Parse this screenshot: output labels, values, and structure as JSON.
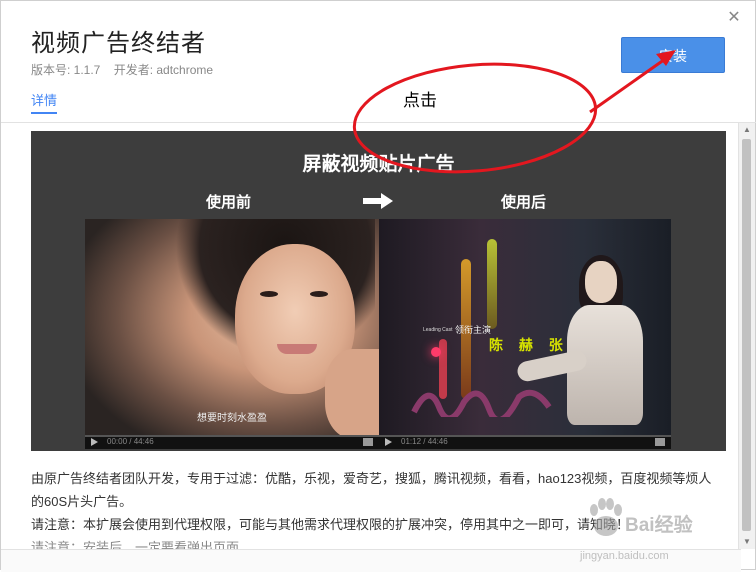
{
  "header": {
    "title": "视频广告终结者",
    "version_label": "版本号: 1.1.7",
    "developer_label": "开发者: adtchrome",
    "install_button": "安装",
    "tab_details": "详情",
    "close_glyph": "✕"
  },
  "banner": {
    "title": "屏蔽视频贴片广告",
    "before_label": "使用前",
    "after_label": "使用后",
    "before_subtitle": "想要时刻水盈盈",
    "after_credit_small": "Leading Cast",
    "after_credit_role": "领衔主演",
    "after_credit_names": "陈 赫 张 萌",
    "before_time": "00:00 / 44:46",
    "after_time": "01:12 / 44:46"
  },
  "annotation": {
    "label": "点击",
    "color": "#e3171f"
  },
  "description": {
    "line1": "由原广告终结者团队开发，专用于过滤：优酷，乐视，爱奇艺，搜狐，腾讯视频，看看，hao123视频，百度视频等烦人的60S片头广告。",
    "line2": "请注意：本扩展会使用到代理权限，可能与其他需求代理权限的扩展冲突，停用其中之一即可，请知晓！",
    "line3": "请注意：安装后，一定要看弹出页面"
  },
  "watermark": {
    "name": "Bai经验",
    "url": "jingyan.baidu.com"
  },
  "colors": {
    "accent": "#4285f4",
    "install_bg": "#4a90e8",
    "banner_bg": "#3d3d3d"
  }
}
